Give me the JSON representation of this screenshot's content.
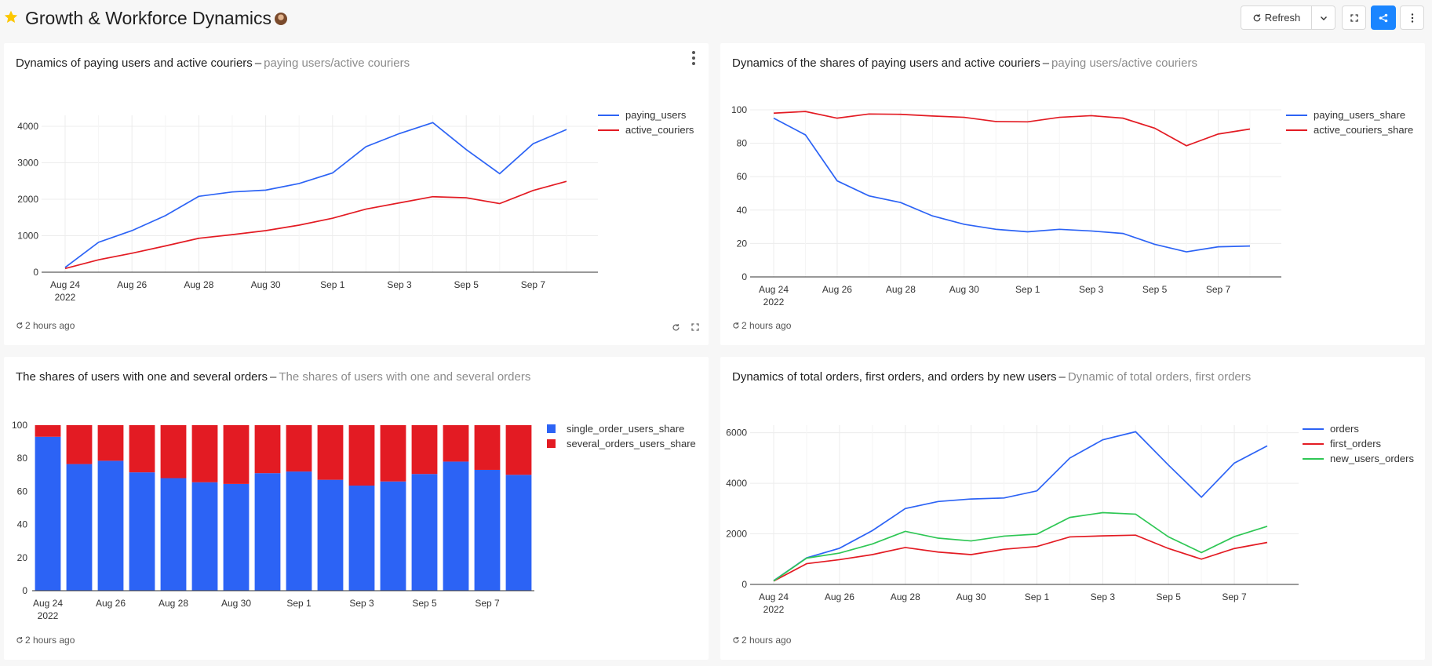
{
  "dashboard": {
    "title": "Growth & Workforce Dynamics",
    "refresh_label": "Refresh",
    "accent_color": "#1a85ff"
  },
  "panels": [
    {
      "title": "Dynamics of paying users and active couriers",
      "subtitle": "paying users/active couriers",
      "footer": "2 hours ago"
    },
    {
      "title": "Dynamics of the shares of paying users and active couriers",
      "subtitle": "paying users/active couriers",
      "footer": "2 hours ago"
    },
    {
      "title": "The shares of users with one and several orders",
      "subtitle": "The shares of users with one and several orders",
      "footer": "2 hours ago"
    },
    {
      "title": "Dynamics of total orders, first orders, and orders by new users",
      "subtitle": "Dynamic of total orders, first orders",
      "footer": "2 hours ago"
    }
  ],
  "chart_data": [
    {
      "type": "line",
      "x": [
        "Aug 24",
        "Aug 25",
        "Aug 26",
        "Aug 27",
        "Aug 28",
        "Aug 29",
        "Aug 30",
        "Aug 31",
        "Sep 1",
        "Sep 2",
        "Sep 3",
        "Sep 4",
        "Sep 5",
        "Sep 6",
        "Sep 7",
        "Sep 8"
      ],
      "xticks": [
        "Aug 24",
        "Aug 26",
        "Aug 28",
        "Aug 30",
        "Sep 1",
        "Sep 3",
        "Sep 5",
        "Sep 7"
      ],
      "year_label": "2022",
      "ylim": [
        0,
        4300
      ],
      "yticks": [
        0,
        1000,
        2000,
        3000,
        4000
      ],
      "legend": "top-right",
      "grid": true,
      "series": [
        {
          "name": "paying_users",
          "color": "#2c63f5",
          "values": [
            130,
            820,
            1140,
            1550,
            2080,
            2200,
            2250,
            2430,
            2720,
            3440,
            3800,
            4100,
            3360,
            2700,
            3520,
            3910
          ]
        },
        {
          "name": "active_couriers",
          "color": "#e31b23",
          "values": [
            100,
            340,
            520,
            720,
            930,
            1030,
            1140,
            1290,
            1480,
            1730,
            1900,
            2070,
            2040,
            1880,
            2240,
            2490
          ]
        }
      ]
    },
    {
      "type": "line",
      "x": [
        "Aug 24",
        "Aug 25",
        "Aug 26",
        "Aug 27",
        "Aug 28",
        "Aug 29",
        "Aug 30",
        "Aug 31",
        "Sep 1",
        "Sep 2",
        "Sep 3",
        "Sep 4",
        "Sep 5",
        "Sep 6",
        "Sep 7",
        "Sep 8"
      ],
      "xticks": [
        "Aug 24",
        "Aug 26",
        "Aug 28",
        "Aug 30",
        "Sep 1",
        "Sep 3",
        "Sep 5",
        "Sep 7"
      ],
      "year_label": "2022",
      "ylim": [
        0,
        100
      ],
      "yticks": [
        0,
        20,
        40,
        60,
        80,
        100
      ],
      "legend": "top-right",
      "grid": true,
      "series": [
        {
          "name": "paying_users_share",
          "color": "#2c63f5",
          "values": [
            95,
            85,
            57.5,
            48.5,
            44.5,
            36.5,
            31.5,
            28.5,
            27,
            28.5,
            27.5,
            26,
            19.5,
            15,
            18,
            18.5
          ]
        },
        {
          "name": "active_couriers_share",
          "color": "#e31b23",
          "values": [
            98,
            99,
            95,
            97.5,
            97.3,
            96.3,
            95.5,
            93,
            92.8,
            95.5,
            96.5,
            95,
            89,
            78.5,
            85.5,
            88.5
          ]
        }
      ]
    },
    {
      "type": "bar",
      "stacked": true,
      "x": [
        "Aug 24",
        "Aug 25",
        "Aug 26",
        "Aug 27",
        "Aug 28",
        "Aug 29",
        "Aug 30",
        "Aug 31",
        "Sep 1",
        "Sep 2",
        "Sep 3",
        "Sep 4",
        "Sep 5",
        "Sep 6",
        "Sep 7",
        "Sep 8"
      ],
      "xticks": [
        "Aug 24",
        "Aug 26",
        "Aug 28",
        "Aug 30",
        "Sep 1",
        "Sep 3",
        "Sep 5",
        "Sep 7"
      ],
      "year_label": "2022",
      "ylim": [
        0,
        100
      ],
      "yticks": [
        0,
        20,
        40,
        60,
        80,
        100
      ],
      "legend": "top-right",
      "series": [
        {
          "name": "single_order_users_share",
          "color": "#2c63f5",
          "values": [
            93,
            76.5,
            78.5,
            71.5,
            68,
            65.5,
            64.5,
            71,
            72,
            67,
            63.5,
            66,
            70.5,
            78,
            73,
            70
          ]
        },
        {
          "name": "several_orders_users_share",
          "color": "#e31b23",
          "values": [
            7,
            23.5,
            21.5,
            28.5,
            32,
            34.5,
            35.5,
            29,
            28,
            33,
            36.5,
            34,
            29.5,
            22,
            27,
            30
          ]
        }
      ]
    },
    {
      "type": "line",
      "x": [
        "Aug 24",
        "Aug 25",
        "Aug 26",
        "Aug 27",
        "Aug 28",
        "Aug 29",
        "Aug 30",
        "Aug 31",
        "Sep 1",
        "Sep 2",
        "Sep 3",
        "Sep 4",
        "Sep 5",
        "Sep 6",
        "Sep 7",
        "Sep 8"
      ],
      "xticks": [
        "Aug 24",
        "Aug 26",
        "Aug 28",
        "Aug 30",
        "Sep 1",
        "Sep 3",
        "Sep 5",
        "Sep 7"
      ],
      "year_label": "2022",
      "ylim": [
        0,
        6300
      ],
      "yticks": [
        0,
        2000,
        4000,
        6000
      ],
      "legend": "top-right",
      "grid": true,
      "series": [
        {
          "name": "orders",
          "color": "#2c63f5",
          "values": [
            150,
            1050,
            1430,
            2130,
            3000,
            3280,
            3380,
            3420,
            3700,
            5000,
            5720,
            6040,
            4720,
            3450,
            4800,
            5480
          ]
        },
        {
          "name": "first_orders",
          "color": "#e31b23",
          "values": [
            130,
            820,
            980,
            1180,
            1460,
            1280,
            1180,
            1390,
            1500,
            1880,
            1920,
            1950,
            1420,
            1000,
            1420,
            1660
          ]
        },
        {
          "name": "new_users_orders",
          "color": "#2fc755",
          "values": [
            140,
            1040,
            1240,
            1600,
            2100,
            1830,
            1720,
            1910,
            1990,
            2650,
            2840,
            2780,
            1880,
            1260,
            1890,
            2300
          ]
        }
      ]
    }
  ]
}
